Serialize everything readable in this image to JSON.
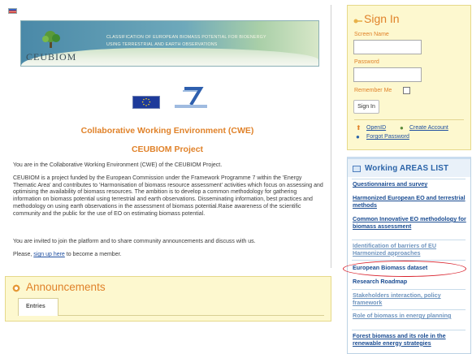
{
  "banner": {
    "line1": "CLASSIFICATION OF EUROPEAN BIOMASS POTENTIAL FOR BIOENERGY",
    "line2": "USING TERRESTRIAL AND EARTH OBSERVATIONS",
    "brand": "CEUBIOM"
  },
  "main": {
    "title": "Collaborative Working Environment (CWE)",
    "subtitle": "CEUBIOM Project",
    "p1": "You are in the Collaborative Working Environment (CWE) of the CEUBIOM Project.",
    "p2": "CEUBIOM is a project funded by the European Commission under the Framework Programme 7 within the 'Energy Thematic Area' and contributes to 'Harmonisation of biomass resource assessment' activities which focus on assessing and optimising the availability of biomass resources. The ambition is to develop a common methodology for gathering information on biomass potential using terrestrial and earth observations. Disseminating information, best practices and methodology on using earth observations in the assessment of biomass potential.Raise awareness of the scientific community and the public for the use of EO on estimating biomass potential.",
    "p3": "You are invited to join the platform and to share community announcements and discuss with us.",
    "p4_prefix": "Please, ",
    "p4_link": "sign up here",
    "p4_suffix": " to become a member."
  },
  "announcements": {
    "title": "Announcements",
    "tab": "Entries"
  },
  "signin": {
    "title": "Sign In",
    "screen_name_label": "Screen Name",
    "password_label": "Password",
    "remember_me": "Remember Me",
    "button": "Sign In",
    "openid": "OpenID",
    "create_account": "Create Account",
    "forgot_password": "Forgot Password"
  },
  "areas": {
    "title": "Working AREAS LIST",
    "items": [
      "Questionnaires and survey",
      "Harmonized European EO and terrestrial methods",
      "Common Innovative EO methodology for biomass assessment",
      "Identification of barriers of EU Harmonized approaches",
      "European Biomass dataset",
      "Research Roadmap",
      "Stakeholders interaction, policy framework",
      "Role of biomass in energy planning",
      "Forest biomass and its role in the renewable energy strategies"
    ]
  },
  "colors": {
    "accent_orange": "#e0822a",
    "link_blue": "#1f4fa0",
    "panel_yellow": "#fdf8cf",
    "highlight_red": "#d9242f"
  }
}
